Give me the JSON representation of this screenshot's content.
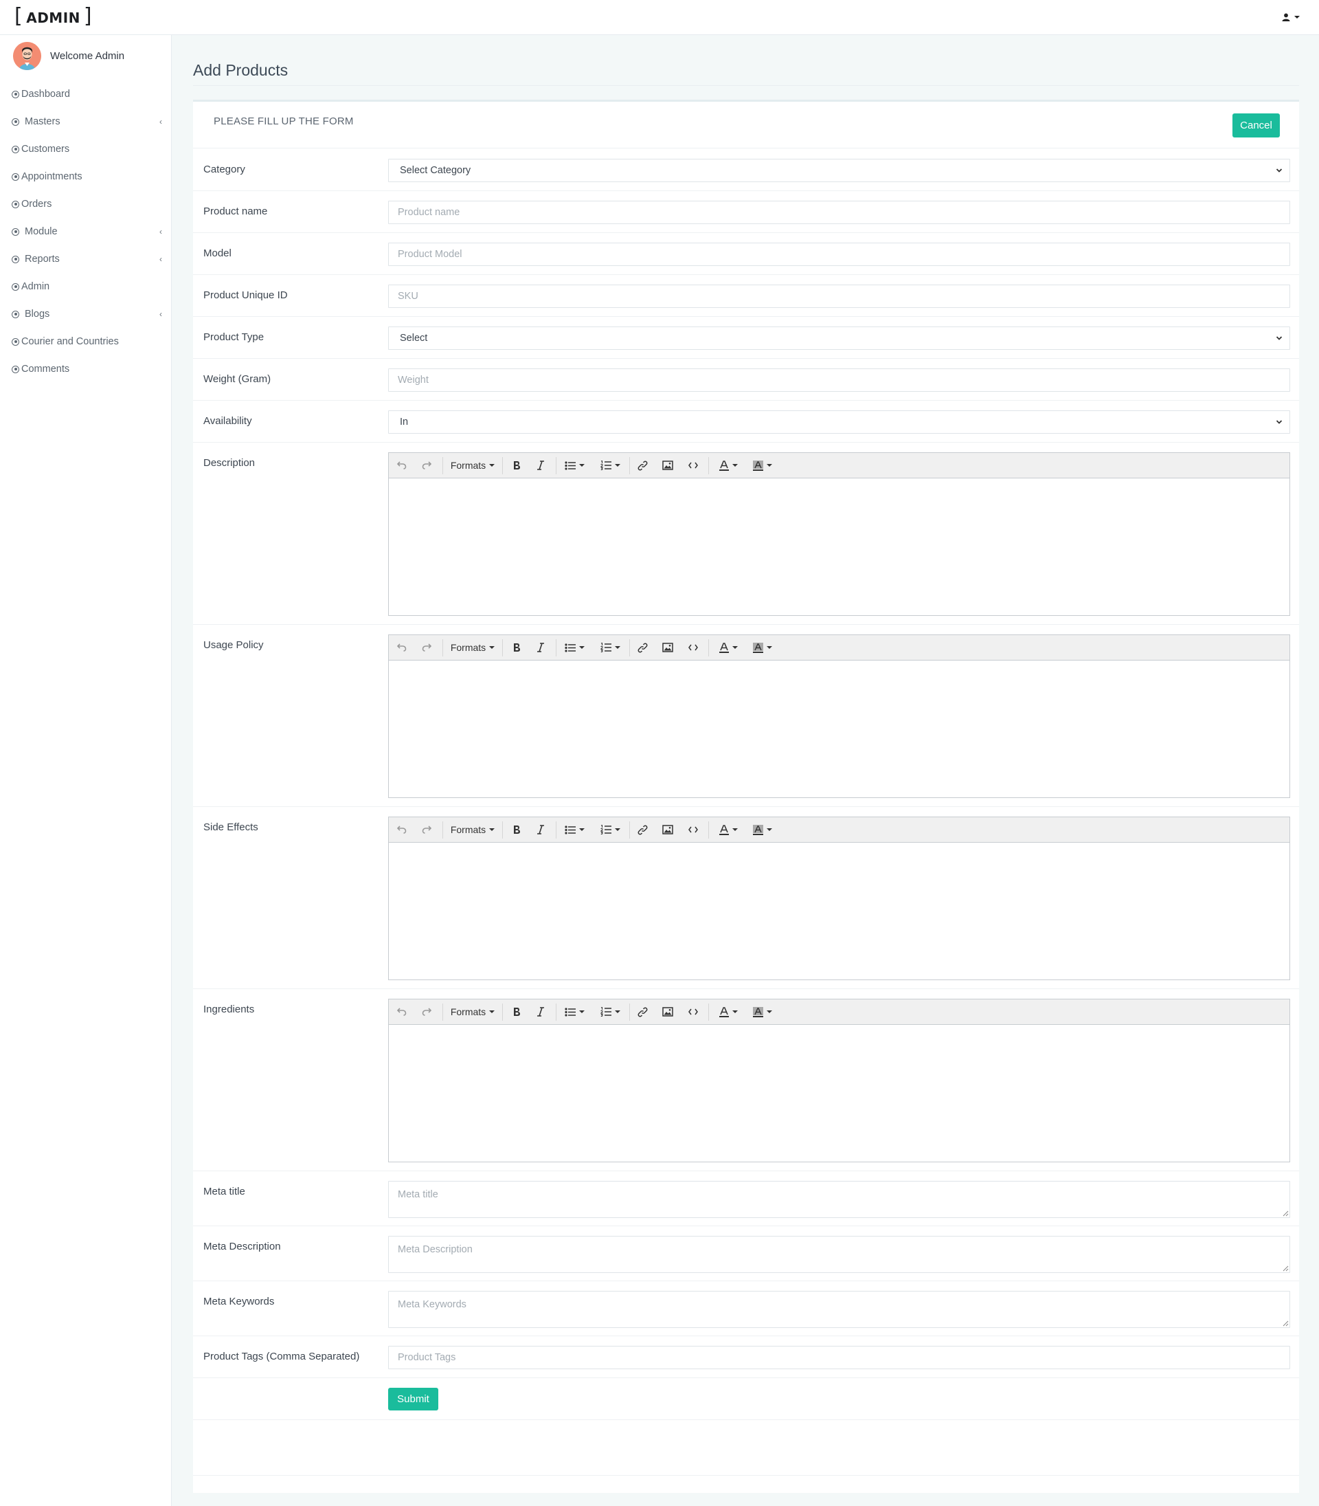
{
  "header": {
    "logo_text": "ADMIN",
    "user_icon": "user-icon"
  },
  "sidebar": {
    "welcome": "Welcome Admin",
    "items": [
      {
        "label": "Dashboard",
        "has_submenu": false
      },
      {
        "label": "Masters",
        "has_submenu": true
      },
      {
        "label": "Customers",
        "has_submenu": false
      },
      {
        "label": "Appointments",
        "has_submenu": false
      },
      {
        "label": "Orders",
        "has_submenu": false
      },
      {
        "label": "Module",
        "has_submenu": true
      },
      {
        "label": "Reports",
        "has_submenu": true
      },
      {
        "label": "Admin",
        "has_submenu": false
      },
      {
        "label": "Blogs",
        "has_submenu": true
      },
      {
        "label": "Courier and Countries",
        "has_submenu": false
      },
      {
        "label": "Comments",
        "has_submenu": false
      }
    ]
  },
  "main": {
    "page_title": "Add Products",
    "form_header": "PLEASE FILL UP THE FORM",
    "cancel_label": "Cancel",
    "submit_label": "Submit",
    "fields": {
      "category": {
        "label": "Category",
        "value": "Select Category"
      },
      "product_name": {
        "label": "Product name",
        "placeholder": "Product name"
      },
      "model": {
        "label": "Model",
        "placeholder": "Product Model"
      },
      "unique_id": {
        "label": "Product Unique ID",
        "placeholder": "SKU"
      },
      "product_type": {
        "label": "Product Type",
        "value": "Select"
      },
      "weight": {
        "label": "Weight (Gram)",
        "placeholder": "Weight"
      },
      "availability": {
        "label": "Availability",
        "value": "In"
      },
      "description": {
        "label": "Description"
      },
      "usage_policy": {
        "label": "Usage Policy"
      },
      "side_effects": {
        "label": "Side Effects"
      },
      "ingredients": {
        "label": "Ingredients"
      },
      "meta_title": {
        "label": "Meta title",
        "placeholder": "Meta title"
      },
      "meta_description": {
        "label": "Meta Description",
        "placeholder": "Meta Description"
      },
      "meta_keywords": {
        "label": "Meta Keywords",
        "placeholder": "Meta Keywords"
      },
      "product_tags": {
        "label": "Product Tags (Comma Separated)",
        "placeholder": "Product Tags"
      }
    },
    "editor_toolbar": {
      "formats_label": "Formats"
    }
  },
  "colors": {
    "accent": "#1abc9c",
    "background": "#f3f8f8",
    "avatar": "#f38c72"
  }
}
